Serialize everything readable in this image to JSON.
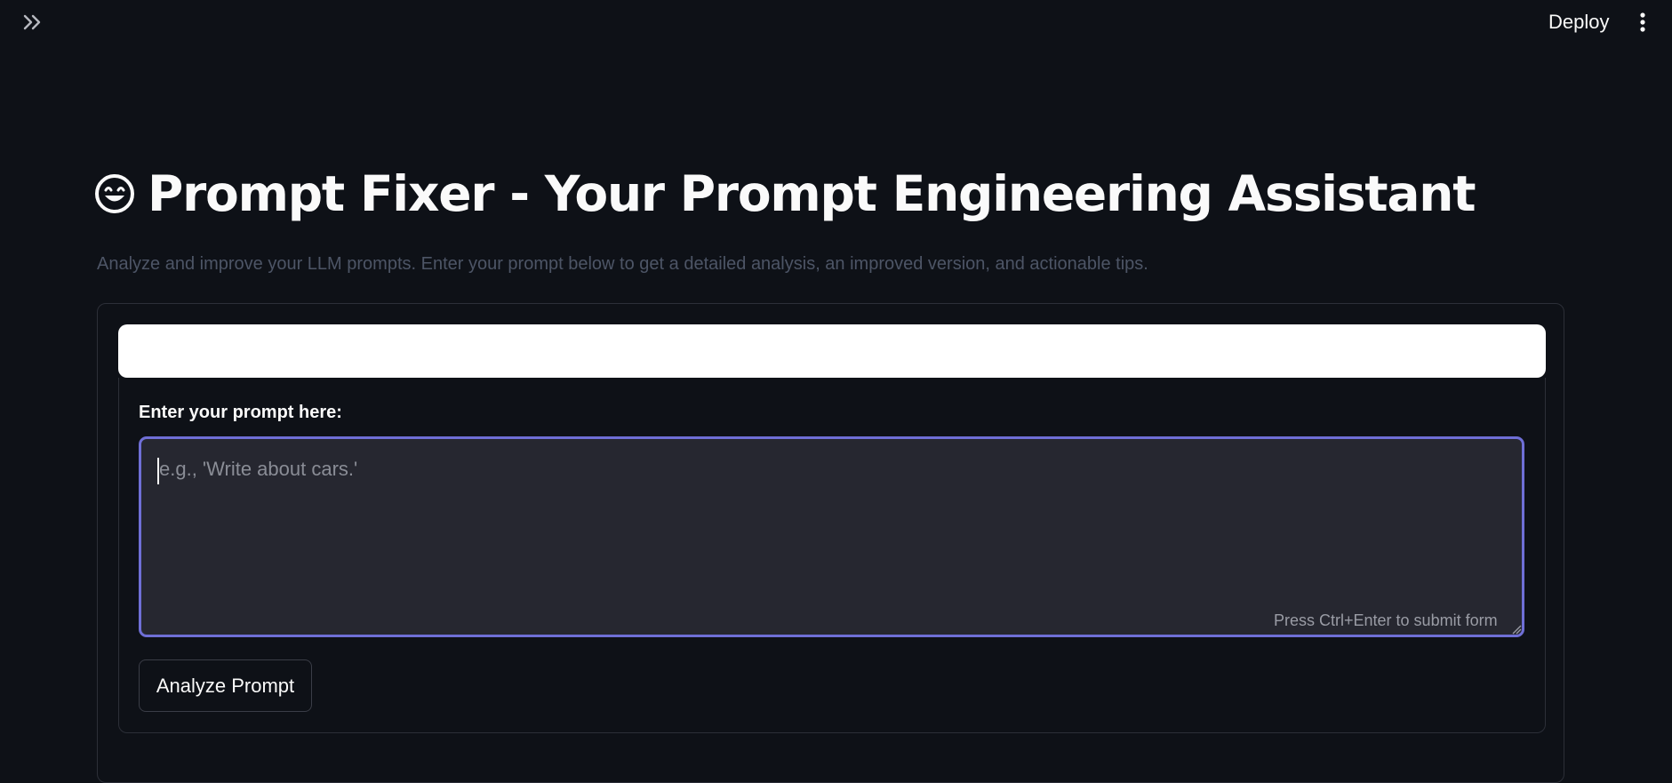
{
  "header": {
    "sidebar_toggle_icon": "double-chevron-right-icon",
    "deploy_label": "Deploy",
    "menu_icon": "vertical-ellipsis-icon"
  },
  "main": {
    "title_icon": "grinning-face-icon",
    "title": "Prompt Fixer - Your Prompt Engineering Assistant",
    "subtitle": "Analyze and improve your LLM prompts. Enter your prompt below to get a detailed analysis, an improved version, and actionable tips."
  },
  "form": {
    "prompt_label": "Enter your prompt here:",
    "prompt_value": "",
    "prompt_placeholder": "e.g., 'Write about cars.'",
    "submit_hint": "Press Ctrl+Enter to submit form",
    "analyze_button_label": "Analyze Prompt"
  },
  "colors": {
    "background": "#0e1117",
    "textarea_bg": "#262730",
    "focus_border": "#6f6fd6",
    "text": "#fafafa",
    "muted_text": "#4d5566"
  }
}
